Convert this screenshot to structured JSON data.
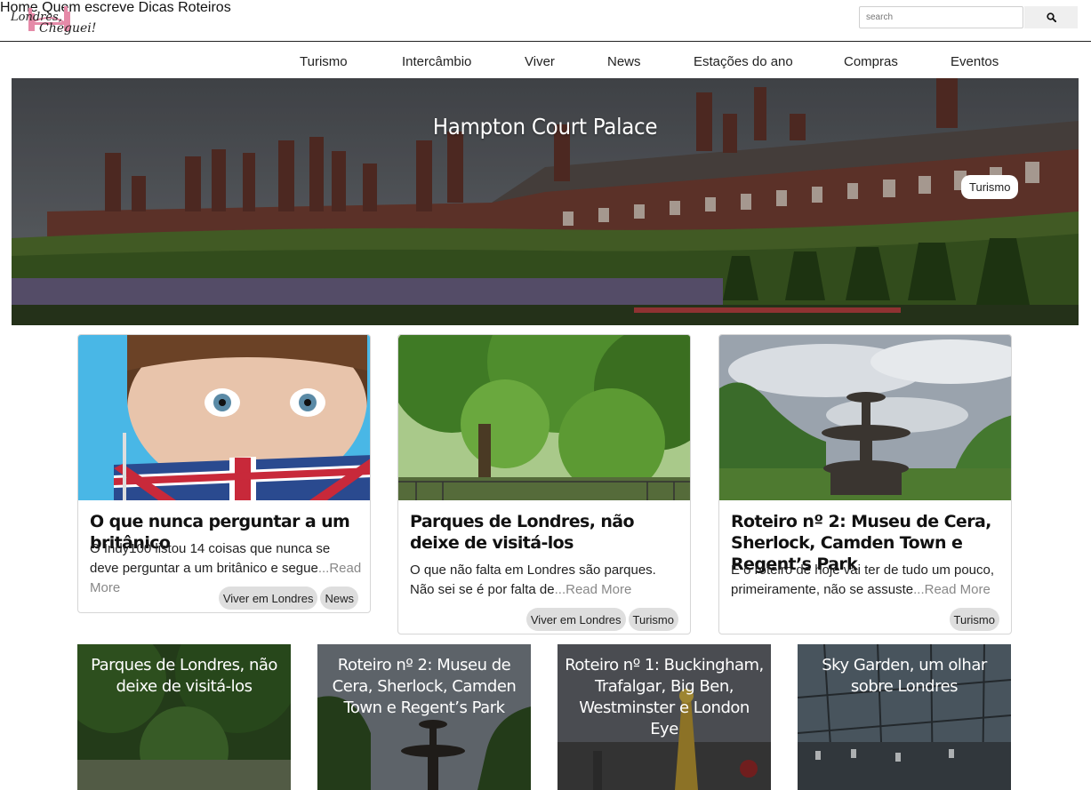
{
  "header": {
    "logo_text": "Londres, Cheguei!",
    "nav": [
      "Home",
      "Quem escreve",
      "Dicas",
      "Roteiros"
    ],
    "search": {
      "placeholder": "search",
      "icon": "search-icon"
    }
  },
  "categories": [
    "Turismo",
    "Intercâmbio",
    "Viver",
    "News",
    "Estações do ano",
    "Compras",
    "Eventos"
  ],
  "hero": {
    "title": "Hampton Court Palace",
    "tag": "Turismo"
  },
  "cards": [
    {
      "title": "O que nunca perguntar a um britânico",
      "excerpt": "O Indy100 listou 14 coisas que nunca se deve perguntar a um britânico e segue",
      "more": "...Read More",
      "tags": [
        "Viver em Londres",
        "News"
      ]
    },
    {
      "title": "Parques de Londres, não deixe de visitá-los",
      "excerpt": "O que não falta em Londres são parques. Não sei se é por falta de",
      "more": "...Read More",
      "tags": [
        "Viver em Londres",
        "Turismo"
      ]
    },
    {
      "title": "Roteiro nº 2: Museu de Cera, Sherlock, Camden Town e Regent’s Park",
      "excerpt": "E o roteiro de hoje vai ter de tudo um pouco, primeiramente, não se assuste",
      "more": "...Read More",
      "tags": [
        "Turismo"
      ]
    }
  ],
  "tiles": [
    {
      "title": "Parques de Londres, não deixe de visitá-los"
    },
    {
      "title": "Roteiro nº 2: Museu de Cera, Sherlock, Camden Town e Regent’s Park"
    },
    {
      "title": "Roteiro nº 1: Buckingham, Trafalgar, Big Ben, Westminster e London Eye"
    },
    {
      "title": "Sky Garden, um olhar sobre Londres"
    }
  ]
}
